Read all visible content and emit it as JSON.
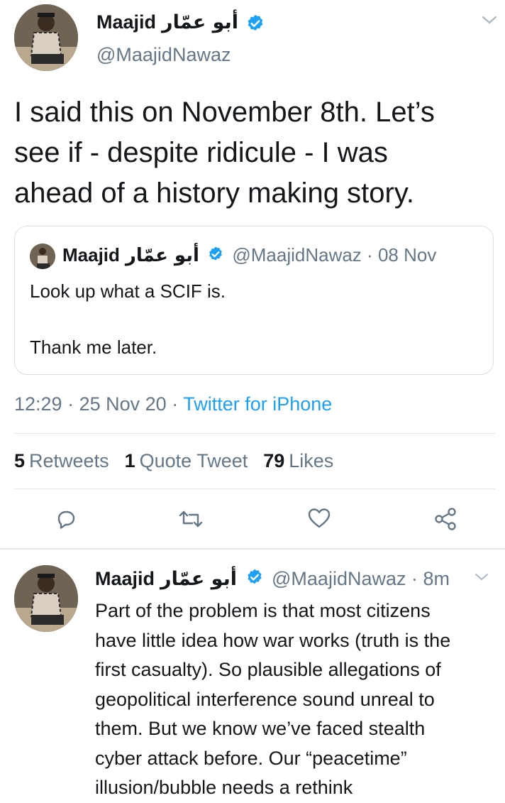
{
  "main_tweet": {
    "author_name": "Maajid",
    "author_arabic": "أبو عمّار",
    "handle": "@MaajidNawaz",
    "text_lines": [
      "I said this on November 8th. Let’s",
      "see if - despite ridicule - I was",
      "ahead of a history making story."
    ],
    "time": "12:29",
    "date": "25 Nov 20",
    "source": "Twitter for iPhone",
    "sep": "·"
  },
  "quoted_tweet": {
    "author_name": "Maajid",
    "author_arabic": "أبو عمّار",
    "handle": "@MaajidNawaz",
    "date": "08 Nov",
    "sep": "·",
    "line1": "Look up what a SCIF is.",
    "line2": "Thank me later."
  },
  "stats": {
    "retweets_count": "5",
    "retweets_label": "Retweets",
    "quotes_count": "1",
    "quotes_label": "Quote Tweet",
    "likes_count": "79",
    "likes_label": "Likes"
  },
  "reply_tweet": {
    "author_name": "Maajid",
    "author_arabic": "أبو عمّار",
    "handle": "@MaajidNawaz",
    "sep": "·",
    "age": "8m",
    "text_lines": [
      "Part of the problem is that most citizens",
      "have little idea how war works (truth is the",
      "first casualty). So plausible allegations of",
      "geopolitical interference sound unreal to",
      "them. But we know we’ve faced stealth",
      "cyber attack before. Our “peacetime”",
      "illusion/bubble needs a rethink"
    ]
  },
  "icons": [
    "verified-badge-icon",
    "chevron-down-icon",
    "reply-icon",
    "retweet-icon",
    "like-icon",
    "share-icon"
  ],
  "colors": {
    "accent": "#1da1f2",
    "text": "#14171a",
    "muted": "#657786",
    "divider": "#e1e8ed"
  }
}
